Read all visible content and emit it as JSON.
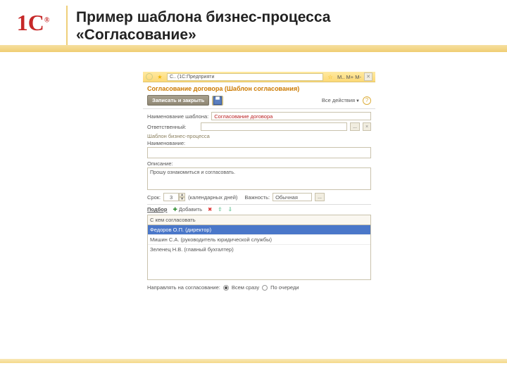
{
  "logo": "1C",
  "slide": {
    "title_line1": "Пример шаблона бизнес-процесса",
    "title_line2": "«Согласование»"
  },
  "toolbar": {
    "address": "С.. (1С:Предприяти",
    "right_hint": "М.. М+ М-"
  },
  "window": {
    "title": "Согласование договора (Шаблон согласования)",
    "btn_save_close": "Записать и закрыть",
    "all_actions": "Все действия",
    "help": "?"
  },
  "form": {
    "template_name_label": "Наименование шаблона:",
    "template_name_value": "Согласование договора",
    "responsible_label": "Ответственный:",
    "bp_template_label": "Шаблон бизнес-процесса",
    "name_label": "Наименование:",
    "description_label": "Описание:",
    "description_value": "Прошу ознакомиться и согласовать.",
    "deadline_label": "Срок:",
    "deadline_value": "3",
    "deadline_unit": "(календарных дней)",
    "importance_label": "Важность:",
    "importance_value": "Обычная"
  },
  "tabs": {
    "select": "Подбор",
    "add": "Добавить"
  },
  "list": {
    "header": "С кем согласовать",
    "rows": [
      "Федоров О.П. (директор)",
      "Мишин С.А. (руководитель юридической службы)",
      "Зеленец Н.В. (главный бухгалтер)"
    ]
  },
  "send": {
    "label": "Направлять на согласование:",
    "opt_all": "Всем сразу",
    "opt_seq": "По очереди"
  }
}
